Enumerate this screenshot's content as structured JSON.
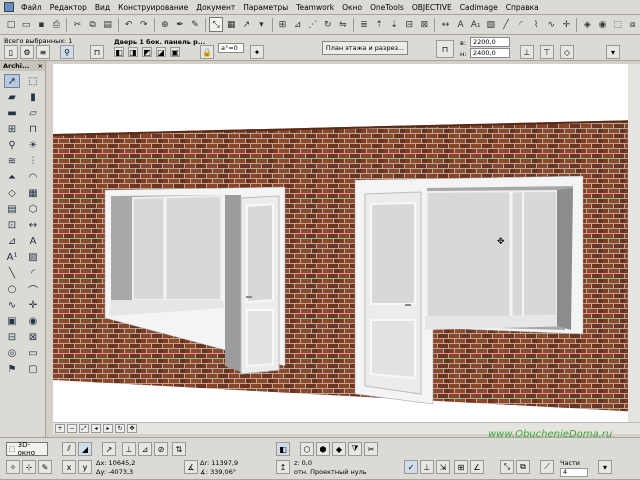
{
  "menubar": {
    "items": [
      "Файл",
      "Редактор",
      "Вид",
      "Конструирование",
      "Документ",
      "Параметры",
      "Teamwork",
      "Окно",
      "OneTools",
      "OBJECTIVE",
      "Cadimage",
      "Справка"
    ]
  },
  "infobox": {
    "selected_count": "Всего выбранных: 1",
    "element_name": "Дверь 1 бок. панель р...",
    "angle_field": "a°=0",
    "plan_button": "План этажа и разрез...",
    "width_label": "в:",
    "width_value": "2200,0",
    "height_label": "н:",
    "height_value": "2400,0"
  },
  "toolbox": {
    "title": "Archi..."
  },
  "bottombar": {
    "view_tab": "3D-окно",
    "dx": "Δx: 10645,2",
    "dy": "Δy: -4073,3",
    "dr": "Δr: 11397,9",
    "da": "∡: 339,06°",
    "z": "z: 0,0",
    "z_ref": "отн. Проектный нуль",
    "parts_label": "Части",
    "parts_value": "4"
  },
  "watermark": "www.ObuchenieDoma.ru",
  "colors": {
    "brick": "#7a3a22",
    "mortar": "#b8a89a",
    "frame": "#f4f4f4",
    "glass": "#d8d8d8",
    "reveal": "#a8a8a8",
    "watermark": "#3ba83b"
  }
}
